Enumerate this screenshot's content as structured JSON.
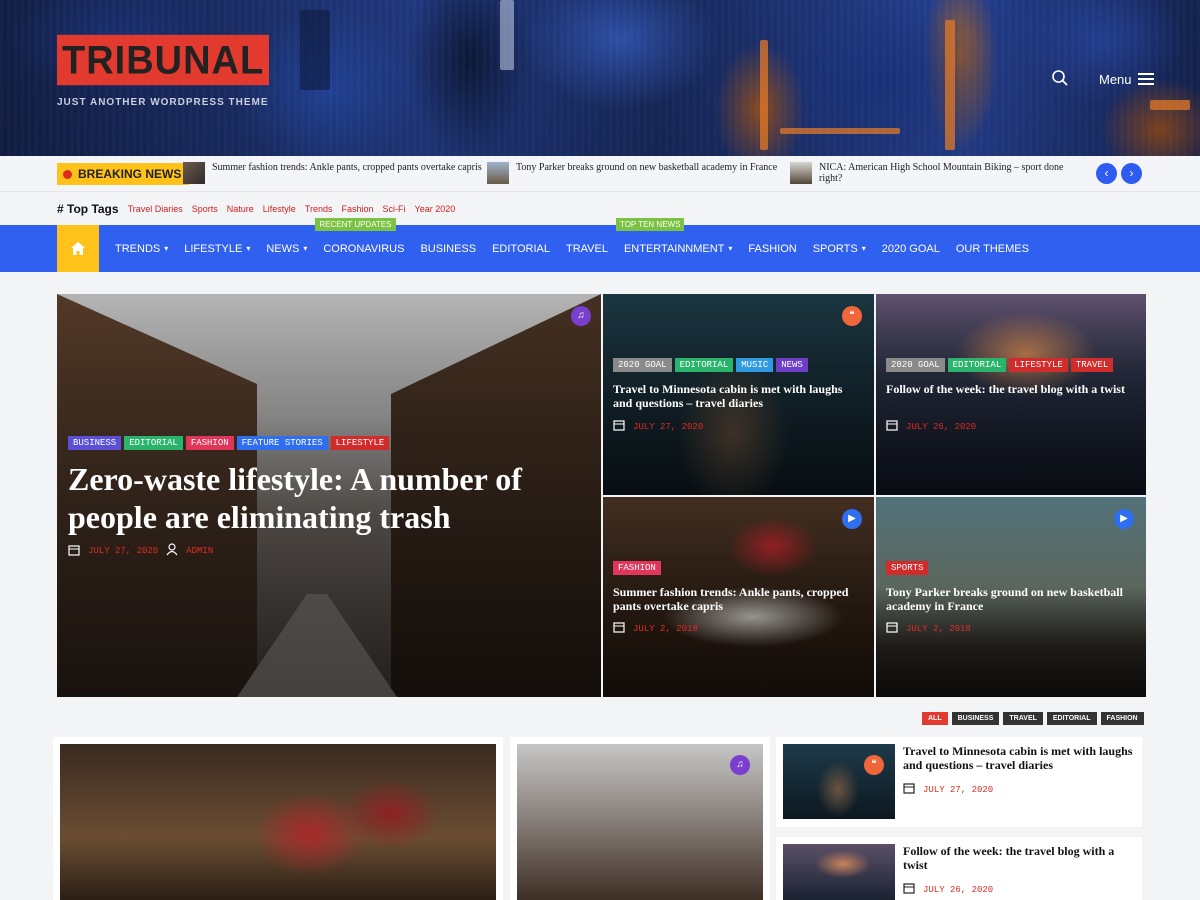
{
  "site": {
    "logo": "TRIBUNAL",
    "tagline": "JUST ANOTHER WORDPRESS THEME",
    "menu_label": "Menu"
  },
  "breaking": {
    "label": "BREAKING NEWS",
    "items": [
      "Summer fashion trends: Ankle pants, cropped pants overtake capris",
      "Tony Parker breaks ground on new basketball academy in France",
      "NICA: American High School Mountain Biking – sport done right?"
    ]
  },
  "top_tags": {
    "title": "# Top Tags",
    "tags": [
      "Travel Diaries",
      "Sports",
      "Nature",
      "Lifestyle",
      "Trends",
      "Fashion",
      "Sci-Fi",
      "Year 2020"
    ]
  },
  "nav": {
    "items": [
      {
        "label": "TRENDS",
        "caret": true
      },
      {
        "label": "LIFESTYLE",
        "caret": true
      },
      {
        "label": "NEWS",
        "caret": true
      },
      {
        "label": "CORONAVIRUS",
        "badge": "RECENT UPDATES"
      },
      {
        "label": "BUSINESS"
      },
      {
        "label": "EDITORIAL"
      },
      {
        "label": "TRAVEL"
      },
      {
        "label": "ENTERTAINNMENT",
        "caret": true,
        "badge": "TOP TEN NEWS"
      },
      {
        "label": "FASHION"
      },
      {
        "label": "SPORTS",
        "caret": true
      },
      {
        "label": "2020 GOAL"
      },
      {
        "label": "OUR THEMES"
      }
    ]
  },
  "featured": {
    "main": {
      "cats": [
        {
          "t": "BUSINESS",
          "c": "#5b4fd6"
        },
        {
          "t": "EDITORIAL",
          "c": "#29b36b"
        },
        {
          "t": "FASHION",
          "c": "#e0365a"
        },
        {
          "t": "FEATURE STORIES",
          "c": "#2f6ef0"
        },
        {
          "t": "LIFESTYLE",
          "c": "#d22b2b"
        }
      ],
      "title": "Zero-waste lifestyle: A number of people are eliminating trash",
      "date": "JULY 27, 2020",
      "author": "ADMIN"
    },
    "grid": [
      {
        "cats": [
          {
            "t": "2020 GOAL",
            "c": "#8a8a8a"
          },
          {
            "t": "EDITORIAL",
            "c": "#29b36b"
          },
          {
            "t": "MUSIC",
            "c": "#2f9ae0"
          },
          {
            "t": "NEWS",
            "c": "#6c3fc6"
          }
        ],
        "title": "Travel to Minnesota cabin is met with laughs and questions – travel diaries",
        "date": "JULY 27, 2020"
      },
      {
        "cats": [
          {
            "t": "2020 GOAL",
            "c": "#8a8a8a"
          },
          {
            "t": "EDITORIAL",
            "c": "#29b36b"
          },
          {
            "t": "LIFESTYLE",
            "c": "#d22b2b"
          },
          {
            "t": "TRAVEL",
            "c": "#d22b2b"
          }
        ],
        "title": "Follow of the week: the travel blog with a twist",
        "date": "JULY 26, 2020"
      },
      {
        "cats": [
          {
            "t": "FASHION",
            "c": "#e0365a"
          }
        ],
        "title": "Summer fashion trends: Ankle pants, cropped pants overtake capris",
        "date": "JULY 2, 2018"
      },
      {
        "cats": [
          {
            "t": "SPORTS",
            "c": "#d22b2b"
          }
        ],
        "title": "Tony Parker breaks ground on new basketball academy in France",
        "date": "JULY 2, 2018"
      }
    ]
  },
  "filters": [
    "ALL",
    "BUSINESS",
    "TRAVEL",
    "EDITORIAL",
    "FASHION"
  ],
  "side_list": [
    {
      "title": "Travel to Minnesota cabin is met with laughs and questions – travel diaries",
      "date": "JULY 27, 2020"
    },
    {
      "title": "Follow of the week: the travel blog with a twist",
      "date": "JULY 26, 2020"
    }
  ],
  "icons": {
    "music": "music-icon",
    "quote": "quote-icon",
    "video": "video-icon"
  },
  "colors": {
    "brand_red": "#e23a2f",
    "nav_blue": "#3060f0",
    "accent_yellow": "#ffc21a",
    "date_red": "#e02b20"
  }
}
